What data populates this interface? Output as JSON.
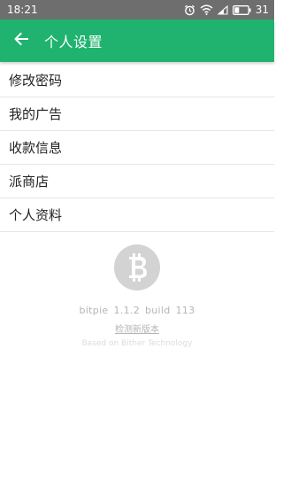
{
  "status_bar": {
    "time": "18:21",
    "battery": "31",
    "icons": [
      "alarm-icon",
      "wifi-icon",
      "signal-icon",
      "battery-icon"
    ]
  },
  "app_bar": {
    "title": "个人设置",
    "back_icon": "arrow-left-icon",
    "color": "#1fb36f"
  },
  "menu": {
    "items": [
      {
        "label": "修改密码"
      },
      {
        "label": "我的广告"
      },
      {
        "label": "收款信息"
      },
      {
        "label": "派商店"
      },
      {
        "label": "个人资料"
      }
    ]
  },
  "about": {
    "logo_icon": "bitcoin-icon",
    "app_name": "bitpie",
    "version": "1.1.2",
    "build_label": "build",
    "build_number": "113",
    "check_update": "检测新版本",
    "based_on": "Based on Bither Technology"
  }
}
